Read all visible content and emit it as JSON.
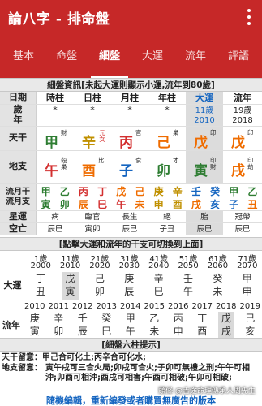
{
  "appbar": {
    "title": "論八字 - 排命盤"
  },
  "tabs": [
    "基本",
    "命盤",
    "細盤",
    "大運",
    "流年",
    "評語"
  ],
  "detail": {
    "header": "細盤資訊[未起大運則顯示小運,流年到80歲]",
    "col_labels": {
      "date": "日期",
      "age": "歲\n年",
      "stem": "天干",
      "branch": "地支",
      "liu_yue": "流月干\n流月支",
      "xingyun": "星運",
      "kongwang": "空亡"
    },
    "columns": [
      "時柱",
      "日柱",
      "月柱",
      "年柱",
      "大運",
      "流年"
    ],
    "age_row": [
      "*",
      "*",
      "*",
      "*",
      "11歲\n2010",
      "19歲\n2018"
    ],
    "stems": [
      {
        "char": "甲",
        "shen": "財",
        "color": "green"
      },
      {
        "char": "辛",
        "shen": "元女",
        "color": "amber"
      },
      {
        "char": "丙",
        "shen": "官",
        "color": "red"
      },
      {
        "char": "己",
        "shen": "梟",
        "color": "orange"
      },
      {
        "char": "戊",
        "shen": "印",
        "color": "orange"
      },
      {
        "char": "戊",
        "shen": "印",
        "color": "orange"
      }
    ],
    "branches": [
      {
        "char": "午",
        "shen": "殺\n梟",
        "color": "red"
      },
      {
        "char": "酉",
        "shen": "比",
        "color": "orange"
      },
      {
        "char": "子",
        "shen": "食",
        "color": "blue"
      },
      {
        "char": "卯",
        "shen": "才",
        "color": "green"
      },
      {
        "char": "寅",
        "shen": "印\n財",
        "color": "green"
      },
      {
        "char": "戌",
        "shen": "印\n劫",
        "color": "orange"
      }
    ],
    "liu_yue_gan": [
      "甲",
      "乙",
      "丙",
      "丁",
      "戊",
      "己",
      "庚",
      "辛",
      "壬",
      "癸",
      "甲",
      "乙"
    ],
    "liu_yue_zhi": [
      "寅",
      "卯",
      "辰",
      "巳",
      "午",
      "未",
      "申",
      "酉",
      "戌",
      "亥",
      "子",
      "丑"
    ],
    "xingyun": [
      "病",
      "臨官",
      "長生",
      "絕",
      "胎",
      "冠帶"
    ],
    "kongwang": [
      "辰巳",
      "寅卯",
      "辰巳",
      "子丑",
      "辰巳",
      "辰巳"
    ]
  },
  "dayun": {
    "header": "[點擊大運和流年的干支可切換到上面]",
    "ages": [
      "1歲",
      "11歲",
      "21歲",
      "31歲",
      "41歲",
      "51歲",
      "61歲",
      "71歲"
    ],
    "years": [
      "2000",
      "2010",
      "2020",
      "2030",
      "2040",
      "2050",
      "2060",
      "2070"
    ],
    "label": "大運",
    "gan": [
      "丁",
      "戊",
      "己",
      "庚",
      "辛",
      "壬",
      "癸",
      "甲"
    ],
    "zhi": [
      "丑",
      "寅",
      "卯",
      "辰",
      "巳",
      "午",
      "未",
      "申"
    ],
    "selected_index": 1
  },
  "liunian": {
    "years": [
      "2010",
      "2011",
      "2012",
      "2013",
      "2014",
      "2015",
      "2016",
      "2017",
      "2018",
      "2019"
    ],
    "label": "流年",
    "gan": [
      "庚",
      "辛",
      "壬",
      "癸",
      "甲",
      "乙",
      "丙",
      "丁",
      "戊",
      "己"
    ],
    "zhi": [
      "寅",
      "卯",
      "辰",
      "巳",
      "午",
      "未",
      "申",
      "酉",
      "戌",
      "亥"
    ],
    "selected_index": 8
  },
  "tips": {
    "header": "[細盤六柱提示]",
    "line1_label": "天干留意：",
    "line1": "甲己合可化土;丙辛合可化水;",
    "line2_label": "地支留意：",
    "line2": "寅午戌可三合火局;卯戌可合火;子卯可無禮之刑;午午可相沖;卯酉可相沖;酉戌可相害;午酉可相破;午卯可相破;",
    "bottom": "隨機編輯，重新編發或者購買無廣告的版本"
  },
  "watermark": "頭條 @吉途命理傳承人周先生"
}
